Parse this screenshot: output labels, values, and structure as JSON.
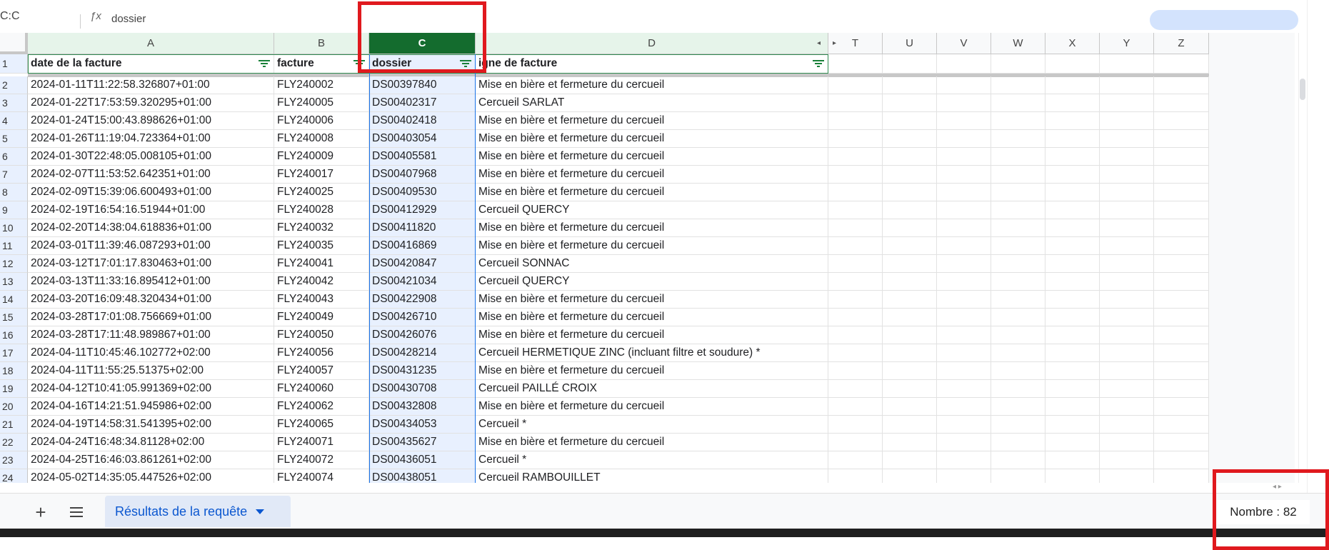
{
  "formula_bar": {
    "cell_ref": "C:C",
    "fx_icon": "fx-icon",
    "value": "dossier"
  },
  "columns": [
    {
      "letter": "A",
      "header": "date de la facture"
    },
    {
      "letter": "B",
      "header": "facture"
    },
    {
      "letter": "C",
      "header": "dossier"
    },
    {
      "letter": "D",
      "header": "igne de facture"
    },
    {
      "letter": "T"
    },
    {
      "letter": "U"
    },
    {
      "letter": "V"
    },
    {
      "letter": "W"
    },
    {
      "letter": "X"
    },
    {
      "letter": "Y"
    },
    {
      "letter": "Z"
    }
  ],
  "header_row_number": "1",
  "rows": [
    {
      "n": "2",
      "a": "2024-01-11T11:22:58.326807+01:00",
      "b": "FLY240002",
      "c": "DS00397840",
      "d": "Mise en bière et fermeture du cercueil"
    },
    {
      "n": "3",
      "a": "2024-01-22T17:53:59.320295+01:00",
      "b": "FLY240005",
      "c": "DS00402317",
      "d": "Cercueil SARLAT"
    },
    {
      "n": "4",
      "a": "2024-01-24T15:00:43.898626+01:00",
      "b": "FLY240006",
      "c": "DS00402418",
      "d": "Mise en bière et fermeture du cercueil"
    },
    {
      "n": "5",
      "a": "2024-01-26T11:19:04.723364+01:00",
      "b": "FLY240008",
      "c": "DS00403054",
      "d": "Mise en bière et fermeture du cercueil"
    },
    {
      "n": "6",
      "a": "2024-01-30T22:48:05.008105+01:00",
      "b": "FLY240009",
      "c": "DS00405581",
      "d": "Mise en bière et fermeture du cercueil"
    },
    {
      "n": "7",
      "a": "2024-02-07T11:53:52.642351+01:00",
      "b": "FLY240017",
      "c": "DS00407968",
      "d": "Mise en bière et fermeture du cercueil"
    },
    {
      "n": "8",
      "a": "2024-02-09T15:39:06.600493+01:00",
      "b": "FLY240025",
      "c": "DS00409530",
      "d": "Mise en bière et fermeture du cercueil"
    },
    {
      "n": "9",
      "a": "2024-02-19T16:54:16.51944+01:00",
      "b": "FLY240028",
      "c": "DS00412929",
      "d": "Cercueil QUERCY"
    },
    {
      "n": "10",
      "a": "2024-02-20T14:38:04.618836+01:00",
      "b": "FLY240032",
      "c": "DS00411820",
      "d": "Mise en bière et fermeture du cercueil"
    },
    {
      "n": "11",
      "a": "2024-03-01T11:39:46.087293+01:00",
      "b": "FLY240035",
      "c": "DS00416869",
      "d": "Mise en bière et fermeture du cercueil"
    },
    {
      "n": "12",
      "a": "2024-03-12T17:01:17.830463+01:00",
      "b": "FLY240041",
      "c": "DS00420847",
      "d": "Cercueil SONNAC"
    },
    {
      "n": "13",
      "a": "2024-03-13T11:33:16.895412+01:00",
      "b": "FLY240042",
      "c": "DS00421034",
      "d": "Cercueil QUERCY"
    },
    {
      "n": "14",
      "a": "2024-03-20T16:09:48.320434+01:00",
      "b": "FLY240043",
      "c": "DS00422908",
      "d": "Mise en bière et fermeture du cercueil"
    },
    {
      "n": "15",
      "a": "2024-03-28T17:01:08.756669+01:00",
      "b": "FLY240049",
      "c": "DS00426710",
      "d": "Mise en bière et fermeture du cercueil"
    },
    {
      "n": "16",
      "a": "2024-03-28T17:11:48.989867+01:00",
      "b": "FLY240050",
      "c": "DS00426076",
      "d": "Mise en bière et fermeture du cercueil"
    },
    {
      "n": "17",
      "a": "2024-04-11T10:45:46.102772+02:00",
      "b": "FLY240056",
      "c": "DS00428214",
      "d": "Cercueil HERMETIQUE ZINC (incluant filtre et soudure) *"
    },
    {
      "n": "18",
      "a": "2024-04-11T11:55:25.51375+02:00",
      "b": "FLY240057",
      "c": "DS00431235",
      "d": "Mise en bière et fermeture du cercueil"
    },
    {
      "n": "19",
      "a": "2024-04-12T10:41:05.991369+02:00",
      "b": "FLY240060",
      "c": "DS00430708",
      "d": "Cercueil PAILLÉ CROIX"
    },
    {
      "n": "20",
      "a": "2024-04-16T14:21:51.945986+02:00",
      "b": "FLY240062",
      "c": "DS00432808",
      "d": "Mise en bière et fermeture du cercueil"
    },
    {
      "n": "21",
      "a": "2024-04-19T14:58:31.541395+02:00",
      "b": "FLY240065",
      "c": "DS00434053",
      "d": "Cercueil *"
    },
    {
      "n": "22",
      "a": "2024-04-24T16:48:34.81128+02:00",
      "b": "FLY240071",
      "c": "DS00435627",
      "d": "Mise en bière et fermeture du cercueil"
    },
    {
      "n": "23",
      "a": "2024-04-25T16:46:03.861261+02:00",
      "b": "FLY240072",
      "c": "DS00436051",
      "d": "Cercueil *"
    },
    {
      "n": "24",
      "a": "2024-05-02T14:35:05.447526+02:00",
      "b": "FLY240074",
      "c": "DS00438051",
      "d": "Cercueil RAMBOUILLET"
    }
  ],
  "bottom": {
    "add_sheet_label": "+",
    "sheet_tab_label": "Résultats de la requête",
    "status_label": "Nombre : 82"
  },
  "colors": {
    "selected_column_header": "#146c2e",
    "highlight_box": "#e0191e",
    "sheet_tab_text": "#0b57d0"
  }
}
